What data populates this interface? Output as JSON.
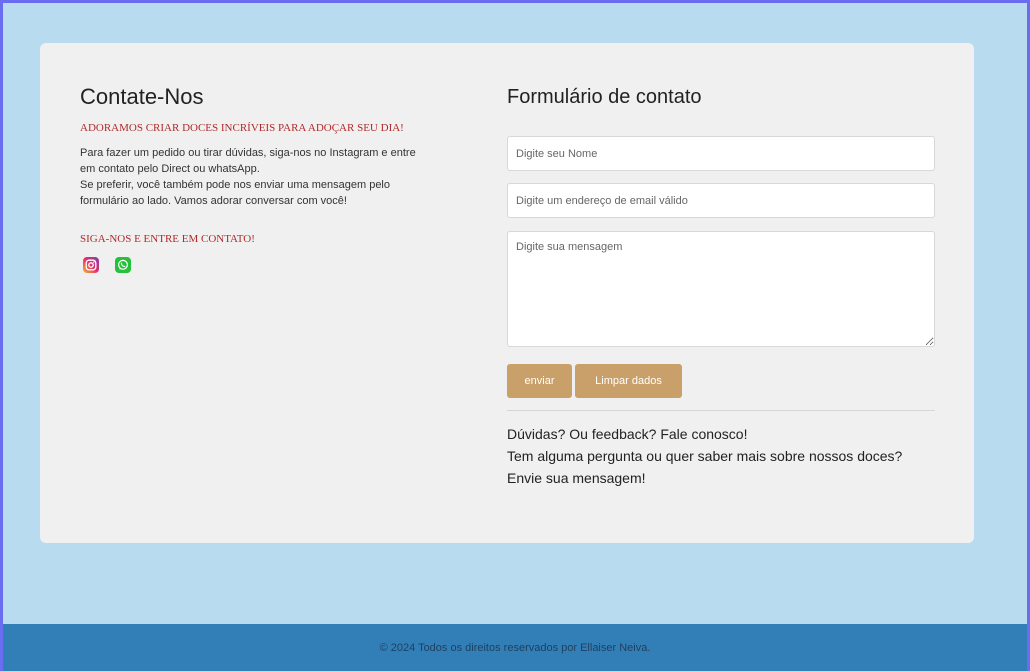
{
  "contact": {
    "title": "Contate-Nos",
    "tagline": "ADORAMOS CRIAR DOCES INCRÍVEIS PARA ADOÇAR SEU DIA!",
    "description_lines": [
      "Para fazer um pedido ou tirar dúvidas, siga-nos no Instagram e entre em contato pelo Direct ou whatsApp.",
      "Se preferir, você também pode nos enviar uma mensagem pelo formulário ao lado. Vamos adorar conversar com você!"
    ],
    "follow_heading": "SIGA-NOS E ENTRE EM CONTATO!",
    "socials": [
      {
        "icon": "instagram-icon",
        "color": "#e1306c"
      },
      {
        "icon": "whatsapp-icon",
        "color": "#25c13b"
      }
    ]
  },
  "form": {
    "title": "Formulário de contato",
    "name_placeholder": "Digite seu Nome",
    "email_placeholder": "Digite um endereço de email válido",
    "message_placeholder": "Digite sua mensagem",
    "name_value": "",
    "email_value": "",
    "message_value": "",
    "send_label": "enviar",
    "clear_label": "Limpar dados",
    "button_color": "#c9a06a"
  },
  "feedback": {
    "line1": "Dúvidas? Ou feedback? Fale conosco!",
    "line2": "Tem alguma pergunta ou quer saber mais sobre nossos doces?",
    "line3": "Envie sua mensagem!"
  },
  "footer": {
    "text": "© 2024 Todos os direitos reservados por Ellaiser Neiva."
  },
  "colors": {
    "page_background": "#b9dbef",
    "card_background": "#f0f0f0",
    "accent_red": "#b02a2a",
    "footer_background": "#327fb7"
  }
}
